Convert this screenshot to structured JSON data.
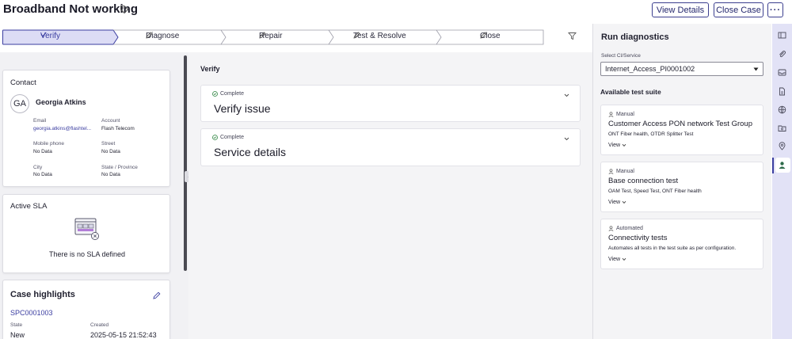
{
  "header": {
    "title": "Broadband Not working",
    "view_details": "View Details",
    "close_case": "Close Case",
    "more": "···"
  },
  "stepper": {
    "steps": [
      {
        "label": "Verify",
        "active": true
      },
      {
        "label": "Diagnose"
      },
      {
        "label": "Repair"
      },
      {
        "label": "Test & Resolve"
      },
      {
        "label": "Close"
      }
    ],
    "active_color": "#dcdcf5"
  },
  "contact": {
    "title": "Contact",
    "initials": "GA",
    "name": "Georgia Atkins",
    "email_label": "Email",
    "email_value": "georgia.atkins@flashtel...",
    "account_label": "Account",
    "account_value": "Flash Telecom",
    "mobile_label": "Mobile phone",
    "mobile_value": "No Data",
    "street_label": "Street",
    "street_value": "No Data",
    "city_label": "City",
    "city_value": "No Data",
    "state_label": "State / Province",
    "state_value": "No Data"
  },
  "sla": {
    "title": "Active SLA",
    "empty_text": "There is no SLA defined"
  },
  "highlights": {
    "title": "Case highlights",
    "case_number": "SPC0001003",
    "state_label": "State",
    "state_value": "New",
    "created_label": "Created",
    "created_value": "2025-05-15 21:52:43"
  },
  "middle": {
    "heading": "Verify",
    "sections": [
      {
        "status": "Complete",
        "title": "Verify issue"
      },
      {
        "status": "Complete",
        "title": "Service details"
      }
    ]
  },
  "diagnostics": {
    "title": "Run diagnostics",
    "select_label": "Select CI/Service",
    "select_value": "Internet_Access_PI0001002",
    "suite_heading": "Available test suite",
    "suites": [
      {
        "type": "Manual",
        "name": "Customer Access PON network Test Group",
        "desc": "ONT Fiber health, OTDR Splitter Test",
        "view": "View"
      },
      {
        "type": "Manual",
        "name": "Base connection test",
        "desc": "OAM Test, Speed Test, ONT Fiber health",
        "view": "View"
      },
      {
        "type": "Automated",
        "name": "Connectivity tests",
        "desc": "Automates all tests in the test suite as per configuration.",
        "view": "View"
      }
    ]
  },
  "colors": {
    "accent": "#3a3da0",
    "complete_green": "#2e8540",
    "rail_bg": "#e2e2f6"
  }
}
